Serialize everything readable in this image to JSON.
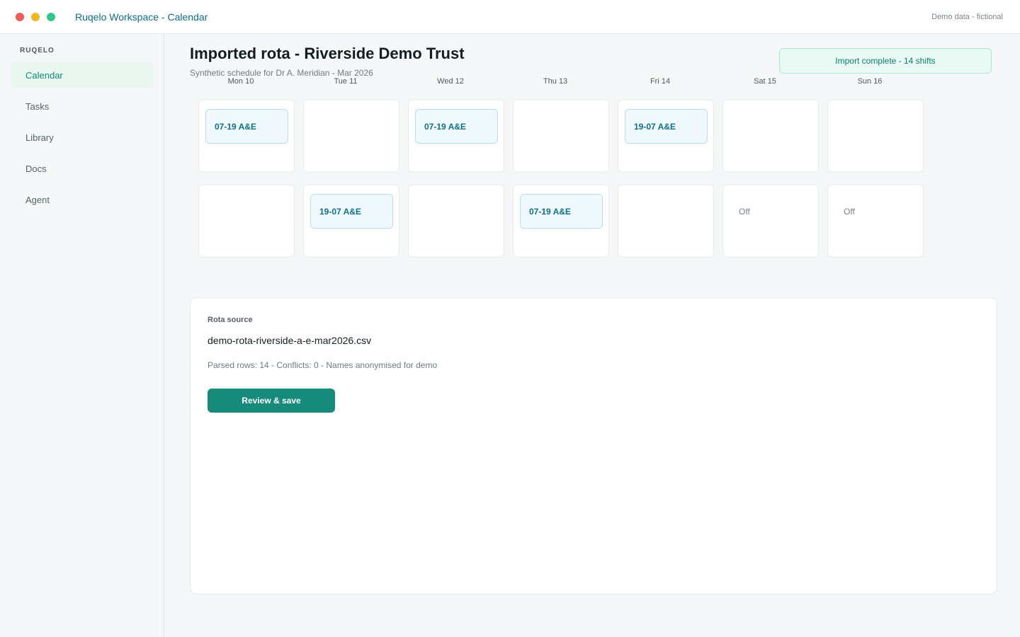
{
  "window": {
    "title": "Ruqelo Workspace - Calendar",
    "demo_note": "Demo data - fictional"
  },
  "sidebar": {
    "brand": "RUQELO",
    "items": [
      {
        "label": "Calendar",
        "active": true
      },
      {
        "label": "Tasks",
        "active": false
      },
      {
        "label": "Library",
        "active": false
      },
      {
        "label": "Docs",
        "active": false
      },
      {
        "label": "Agent",
        "active": false
      }
    ]
  },
  "header": {
    "title": "Imported rota - Riverside Demo Trust",
    "subtitle": "Synthetic schedule for Dr A. Meridian - Mar 2026",
    "import_status": "Import complete - 14 shifts"
  },
  "calendar": {
    "days": [
      "Mon 10",
      "Tue 11",
      "Wed 12",
      "Thu 13",
      "Fri 14",
      "Sat 15",
      "Sun 16"
    ],
    "weeks": [
      [
        {
          "shift": "07-19 A&E"
        },
        {},
        {
          "shift": "07-19 A&E"
        },
        {},
        {
          "shift": "19-07 A&E"
        },
        {},
        {}
      ],
      [
        {},
        {
          "shift": "19-07 A&E"
        },
        {},
        {
          "shift": "07-19 A&E"
        },
        {},
        {
          "off": "Off"
        },
        {
          "off": "Off"
        }
      ]
    ]
  },
  "source": {
    "label": "Rota source",
    "filename": "demo-rota-riverside-a-e-mar2026.csv",
    "meta": "Parsed rows: 14 - Conflicts: 0 - Names anonymised for demo",
    "button_label": "Review & save"
  },
  "colors": {
    "accent": "#168b7b",
    "title_blue": "#0f6f86",
    "shift_bg": "#eff8fd",
    "badge_bg": "#e8faf3"
  }
}
